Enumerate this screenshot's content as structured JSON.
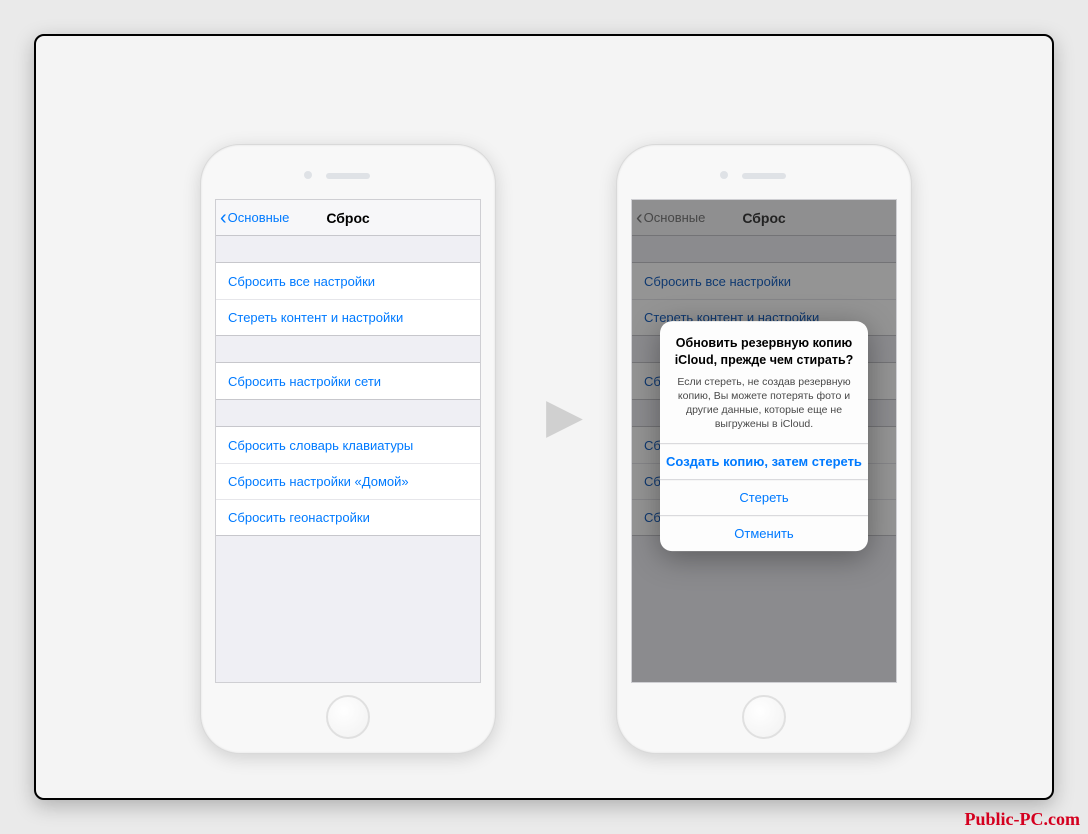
{
  "watermark": "Public-PC.com",
  "nav": {
    "back_label": "Основные",
    "title": "Сброс"
  },
  "reset_rows": {
    "all_settings": "Сбросить все настройки",
    "erase_content": "Стереть контент и настройки",
    "network": "Сбросить настройки сети",
    "keyboard": "Сбросить словарь клавиатуры",
    "home": "Сбросить настройки «Домой»",
    "location": "Сбросить геонастройки"
  },
  "alert": {
    "title": "Обновить резервную копию iCloud, прежде чем стирать?",
    "message": "Если стереть, не создав резервную копию, Вы можете потерять фото и другие данные, которые еще не выгружены в iCloud.",
    "backup_then_erase": "Создать копию, затем стереть",
    "erase": "Стереть",
    "cancel": "Отменить"
  }
}
